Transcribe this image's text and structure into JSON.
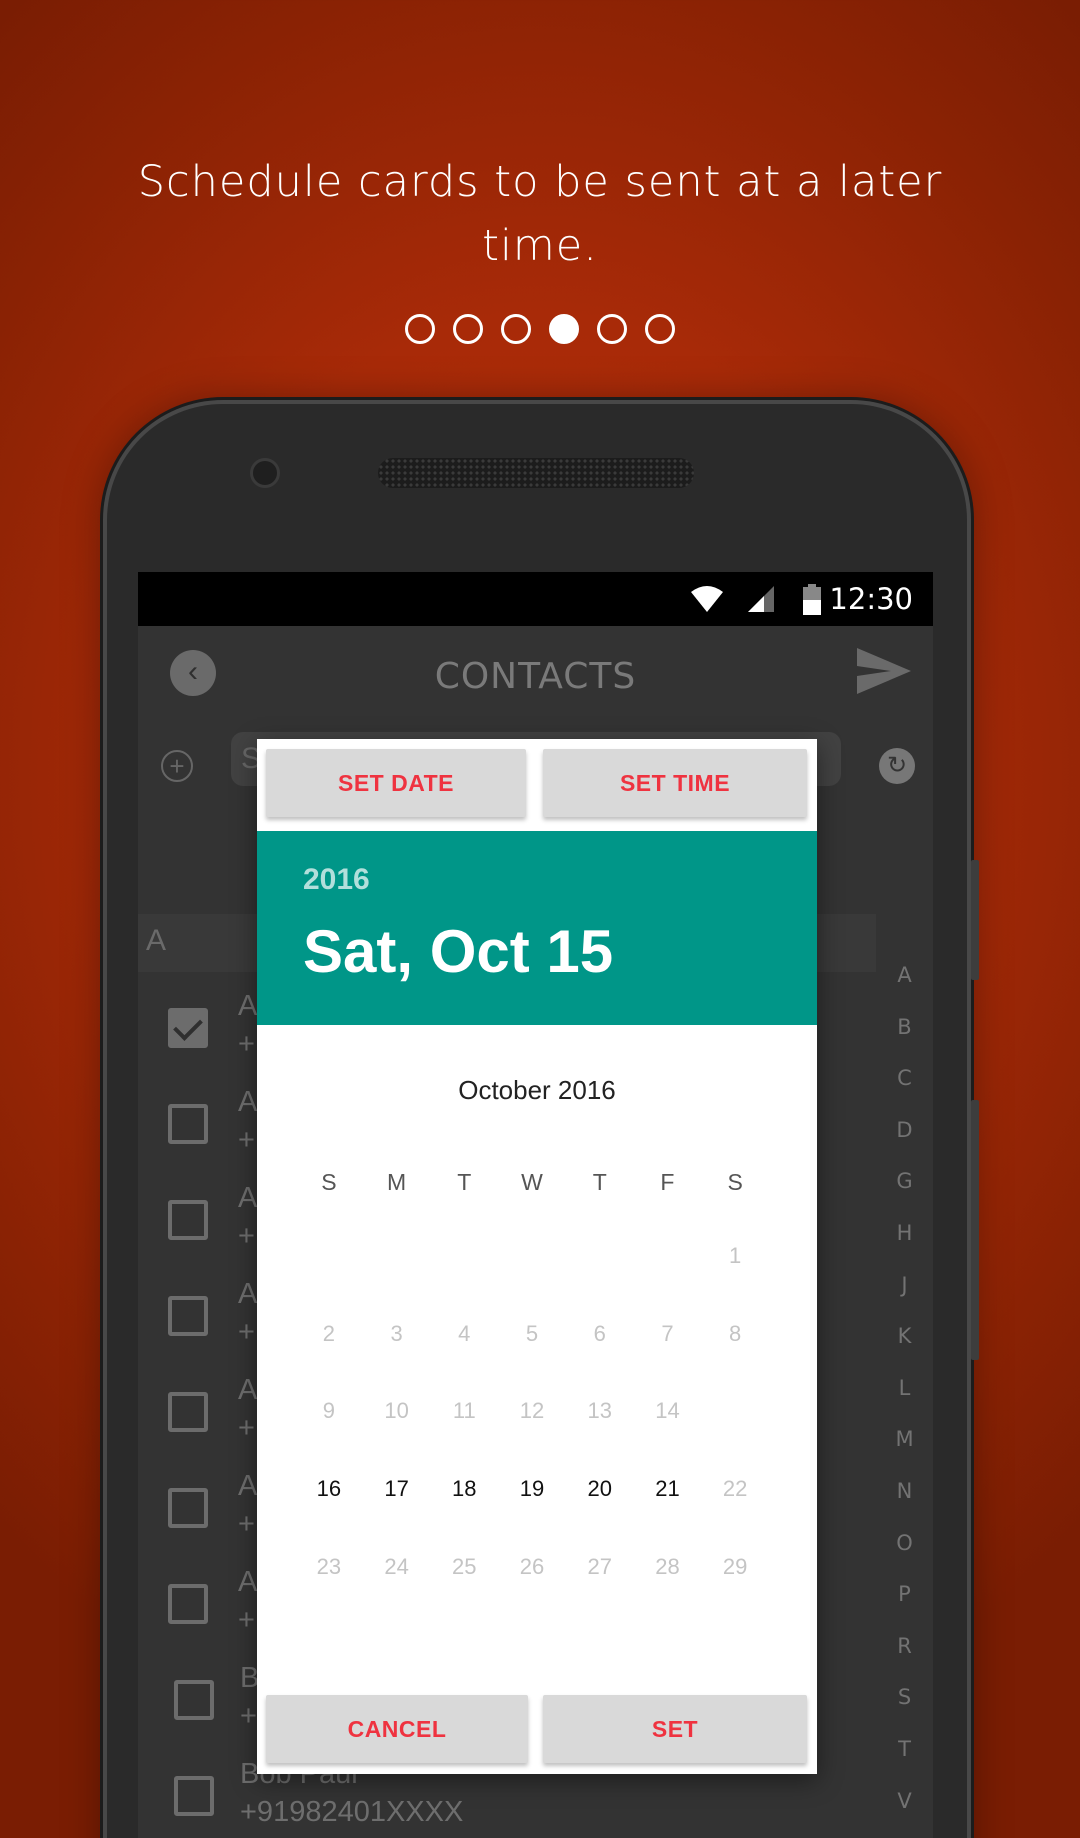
{
  "onboarding": {
    "headline": "Schedule cards to be sent at a later time.",
    "pager_total": 6,
    "pager_active_index": 3
  },
  "status_bar": {
    "time": "12:30",
    "icons": [
      "wifi-icon",
      "cellular-signal-icon",
      "battery-icon"
    ]
  },
  "app_bar": {
    "title": "CONTACTS",
    "back_icon": "chevron-left-icon",
    "send_icon": "send-icon"
  },
  "search": {
    "add_icon": "plus-icon",
    "placeholder_visible": "S",
    "sync_icon": "sync-icon"
  },
  "contacts": {
    "section_letter": "A",
    "items": [
      {
        "name": "A",
        "phone": "+",
        "checked": true
      },
      {
        "name": "A",
        "phone": "+",
        "checked": false
      },
      {
        "name": "A",
        "phone": "+",
        "checked": false
      },
      {
        "name": "A",
        "phone": "+",
        "checked": false
      },
      {
        "name": "A",
        "phone": "+",
        "checked": false
      },
      {
        "name": "A",
        "phone": "+",
        "checked": false
      },
      {
        "name": "A",
        "phone": "+",
        "checked": false
      },
      {
        "name": "B",
        "phone": "+",
        "checked": false
      },
      {
        "name": "Bob Paul",
        "phone": "+91982401XXXX",
        "checked": false
      }
    ],
    "alpha_index": [
      "A",
      "B",
      "C",
      "D",
      "G",
      "H",
      "J",
      "K",
      "L",
      "M",
      "N",
      "O",
      "P",
      "R",
      "S",
      "T",
      "V"
    ]
  },
  "date_dialog": {
    "tab_set_date": "SET DATE",
    "tab_set_time": "SET TIME",
    "year": "2016",
    "selected_date": "Sat, Oct 15",
    "month_title": "October 2016",
    "weekdays": [
      "S",
      "M",
      "T",
      "W",
      "T",
      "F",
      "S"
    ],
    "weeks": [
      [
        "",
        "",
        "",
        "",
        "",
        "",
        "1"
      ],
      [
        "2",
        "3",
        "4",
        "5",
        "6",
        "7",
        "8"
      ],
      [
        "9",
        "10",
        "11",
        "12",
        "13",
        "14",
        ""
      ],
      [
        "16",
        "17",
        "18",
        "19",
        "20",
        "21",
        "22"
      ],
      [
        "23",
        "24",
        "25",
        "26",
        "27",
        "28",
        "29"
      ]
    ],
    "enabled_days": [
      "16",
      "17",
      "18",
      "19",
      "20",
      "21"
    ],
    "cancel_label": "CANCEL",
    "set_label": "SET",
    "accent_color": "#009688",
    "button_text_color": "#ef3340"
  }
}
